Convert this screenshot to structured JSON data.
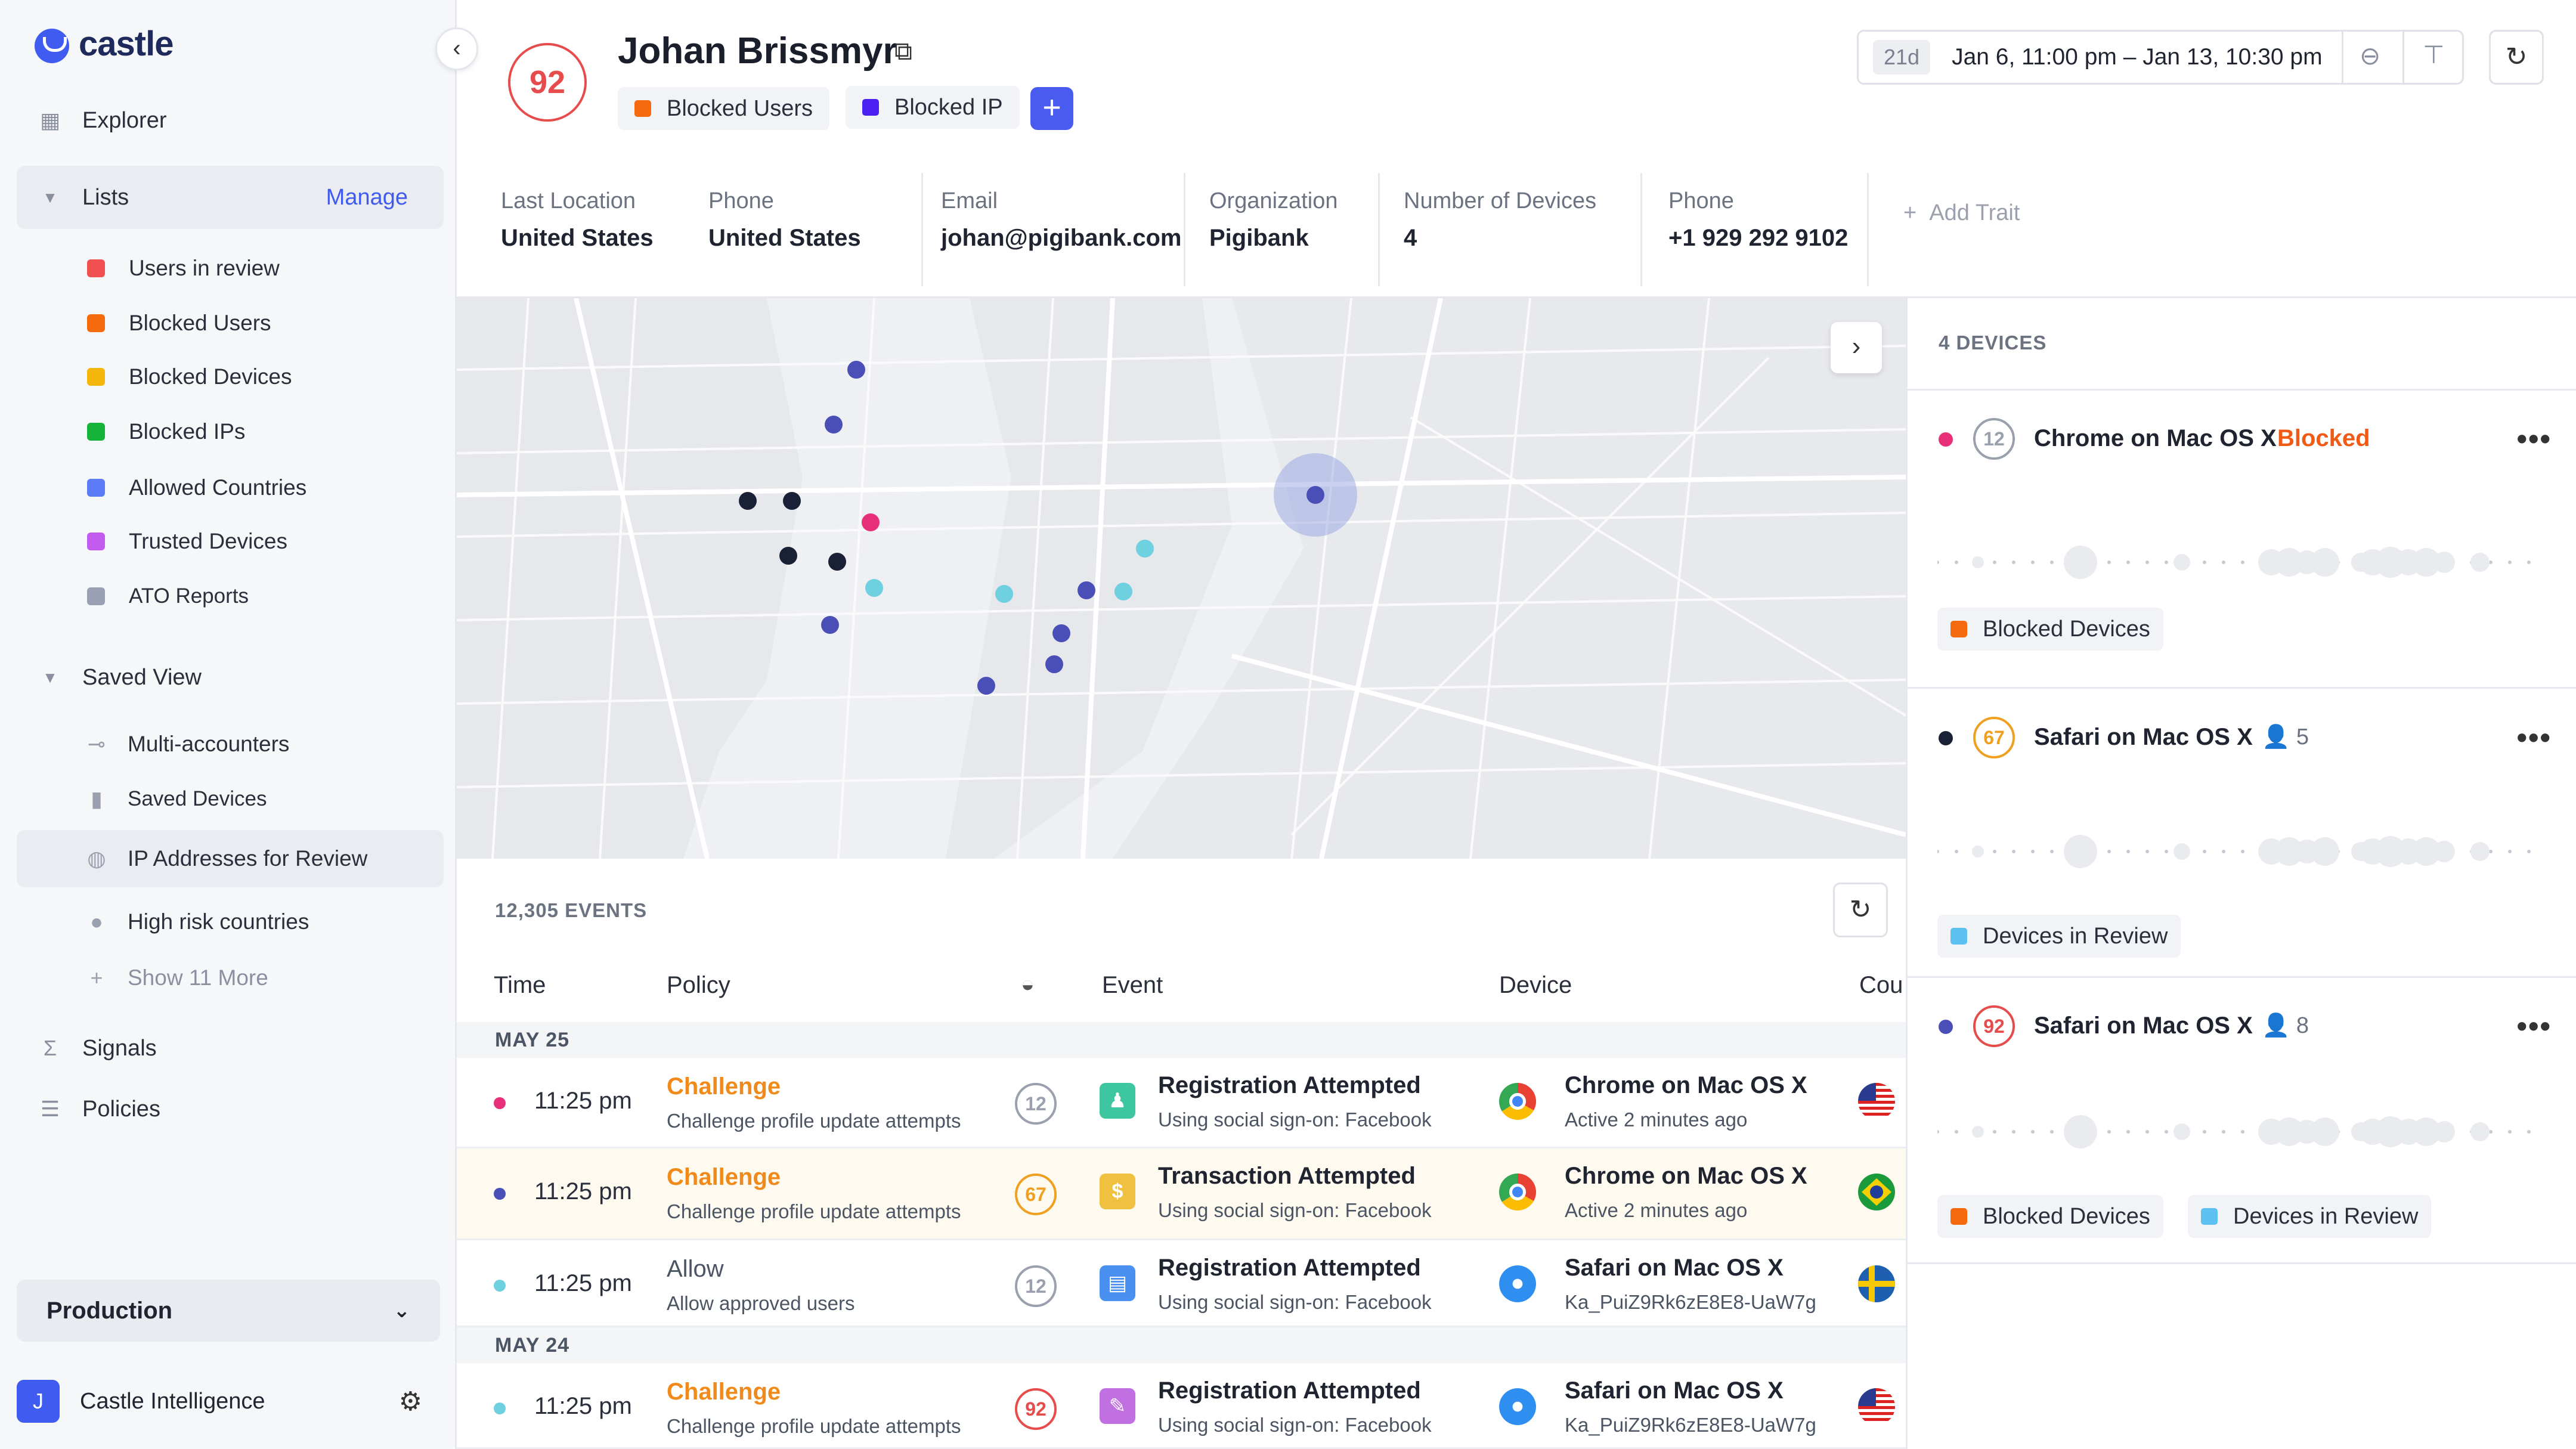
{
  "app": {
    "brand": "castle"
  },
  "sidebar": {
    "explorer": "Explorer",
    "lists_label": "Lists",
    "manage": "Manage",
    "lists": [
      {
        "label": "Users in review",
        "color": "#f05050"
      },
      {
        "label": "Blocked Users",
        "color": "#f56a0c"
      },
      {
        "label": "Blocked Devices",
        "color": "#f5b60c"
      },
      {
        "label": "Blocked IPs",
        "color": "#16b33a"
      },
      {
        "label": "Allowed Countries",
        "color": "#5b7cf6"
      },
      {
        "label": "Trusted Devices",
        "color": "#c45bf0"
      },
      {
        "label": "ATO Reports",
        "color": "#9aa0b4"
      }
    ],
    "saved_view_label": "Saved View",
    "saved_views": [
      {
        "label": "Multi-accounters",
        "icon": "link-icon"
      },
      {
        "label": "Saved Devices",
        "icon": "device-icon"
      },
      {
        "label": "IP Addresses for Review",
        "icon": "globe-icon"
      },
      {
        "label": "High risk countries",
        "icon": "pin-icon"
      }
    ],
    "show_more": "Show 11 More",
    "signals": "Signals",
    "policies": "Policies",
    "environment": "Production",
    "account_initial": "J",
    "account_name": "Castle Intelligence"
  },
  "header": {
    "score": "92",
    "user_name": "Johan Brissmyr",
    "chips": [
      {
        "label": "Blocked Users",
        "color": "#f56a0c"
      },
      {
        "label": "Blocked IP",
        "color": "#4b1ff0"
      }
    ],
    "range_badge": "21d",
    "date_range": "Jan 6, 11:00 pm – Jan 13, 10:30 pm"
  },
  "traits": [
    {
      "label": "Last Location",
      "value": "United States"
    },
    {
      "label": "Phone",
      "value": "United States"
    },
    {
      "label": "Email",
      "value": "johan@pigibank.com"
    },
    {
      "label": "Organization",
      "value": "Pigibank"
    },
    {
      "label": "Number of Devices",
      "value": "4"
    },
    {
      "label": "Phone",
      "value": "+1 929 292 9102"
    }
  ],
  "add_trait": "Add Trait",
  "events": {
    "count_label": "12,305 EVENTS",
    "columns": {
      "time": "Time",
      "policy": "Policy",
      "event": "Event",
      "device": "Device",
      "country": "Cou"
    },
    "groups": [
      {
        "date": "MAY 25"
      },
      {
        "date": "MAY 24"
      }
    ],
    "rows": [
      {
        "dot": "#e8307a",
        "time": "11:25 pm",
        "policy": "Challenge",
        "policy_desc": "Challenge profile update attempts",
        "score": "12",
        "score_color": "#9aa0ad",
        "event_icon_color": "#3ec6a0",
        "event_icon": "person-icon",
        "event": "Registration Attempted",
        "event_desc": "Using social sign-on: Facebook",
        "browser": "chrome-icon",
        "device": "Chrome on Mac OS X",
        "device_desc": "Active 2 minutes ago",
        "flag": "us-flag-icon"
      },
      {
        "dot": "#4a4fb8",
        "time": "11:25 pm",
        "policy": "Challenge",
        "policy_desc": "Challenge profile update attempts",
        "score": "67",
        "score_color": "#f0a020",
        "event_icon_color": "#f0c040",
        "event_icon": "dollar-icon",
        "event": "Transaction Attempted",
        "event_desc": "Using social sign-on: Facebook",
        "browser": "chrome-icon",
        "device": "Chrome on Mac OS X",
        "device_desc": "Active 2 minutes ago",
        "flag": "br-flag-icon"
      },
      {
        "dot": "#6fd0e0",
        "time": "11:25 pm",
        "policy": "Allow",
        "policy_desc": "Allow approved users",
        "score": "12",
        "score_color": "#9aa0ad",
        "event_icon_color": "#4a90f0",
        "event_icon": "document-icon",
        "event": "Registration Attempted",
        "event_desc": "Using social sign-on: Facebook",
        "browser": "safari-icon",
        "device": "Safari on Mac OS X",
        "device_desc": "Ka_PuiZ9Rk6zE8E8-UaW7g",
        "flag": "se-flag-icon"
      },
      {
        "dot": "#6fd0e0",
        "time": "11:25 pm",
        "policy": "Challenge",
        "policy_desc": "Challenge profile update attempts",
        "score": "92",
        "score_color": "#e74c4c",
        "event_icon_color": "#c070e0",
        "event_icon": "pencil-icon",
        "event": "Registration Attempted",
        "event_desc": "Using social sign-on: Facebook",
        "browser": "safari-icon",
        "device": "Safari on Mac OS X",
        "device_desc": "Ka_PuiZ9Rk6zE8E8-UaW7g",
        "flag": "us-flag-icon"
      }
    ]
  },
  "devices": {
    "count_label": "4 DEVICES",
    "items": [
      {
        "dot": "#e8307a",
        "score": "12",
        "score_color": "#9aa0ad",
        "name": "Chrome on Mac OS X",
        "status": "Blocked",
        "users": "",
        "lists": [
          {
            "label": "Blocked Devices",
            "color": "#f56a0c"
          }
        ]
      },
      {
        "dot": "#1a2035",
        "score": "67",
        "score_color": "#f0a020",
        "name": "Safari on Mac OS X",
        "status": "",
        "users": "5",
        "lists": [
          {
            "label": "Devices in Review",
            "color": "#5cc0f0"
          }
        ]
      },
      {
        "dot": "#4a4fb8",
        "score": "92",
        "score_color": "#e74c4c",
        "name": "Safari on Mac OS X",
        "status": "",
        "users": "8",
        "lists": [
          {
            "label": "Blocked Devices",
            "color": "#f56a0c"
          },
          {
            "label": "Devices in Review",
            "color": "#5cc0f0"
          }
        ]
      }
    ]
  },
  "map": {
    "points": [
      {
        "c": "#4a4fb8"
      },
      {
        "c": "#4a4fb8"
      },
      {
        "c": "#1a2035"
      },
      {
        "c": "#1a2035"
      },
      {
        "c": "#e8307a"
      },
      {
        "c": "#1a2035"
      },
      {
        "c": "#1a2035"
      },
      {
        "c": "#6fd0e0"
      },
      {
        "c": "#4a4fb8"
      },
      {
        "c": "#4a4fb8"
      },
      {
        "c": "#6fd0e0"
      },
      {
        "c": "#4a4fb8"
      },
      {
        "c": "#4a4fb8"
      },
      {
        "c": "#4a4fb8"
      },
      {
        "c": "#6fd0e0"
      },
      {
        "c": "#6fd0e0"
      },
      {
        "c": "#4a4fb8"
      }
    ]
  }
}
